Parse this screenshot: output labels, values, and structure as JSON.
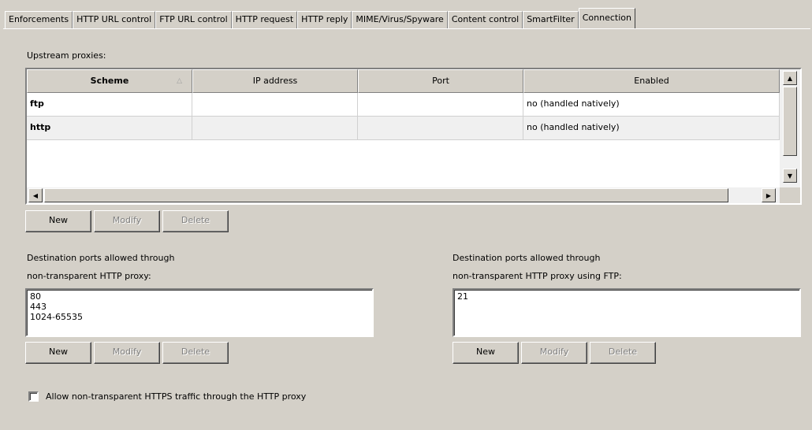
{
  "tabs": [
    {
      "label": "Enforcements",
      "active": false
    },
    {
      "label": "HTTP URL control",
      "active": false
    },
    {
      "label": "FTP URL control",
      "active": false
    },
    {
      "label": "HTTP request",
      "active": false
    },
    {
      "label": "HTTP reply",
      "active": false
    },
    {
      "label": "MIME/Virus/Spyware",
      "active": false
    },
    {
      "label": "Content control",
      "active": false
    },
    {
      "label": "SmartFilter",
      "active": false
    },
    {
      "label": "Connection",
      "active": true
    }
  ],
  "upstream": {
    "label": "Upstream proxies:",
    "columns": [
      "Scheme",
      "IP address",
      "Port",
      "Enabled"
    ],
    "sort_glyph": "△",
    "rows": [
      {
        "scheme": "ftp",
        "ip": "",
        "port": "",
        "enabled": "no (handled natively)"
      },
      {
        "scheme": "http",
        "ip": "",
        "port": "",
        "enabled": "no (handled natively)"
      }
    ],
    "buttons": {
      "new": "New",
      "modify": "Modify",
      "delete": "Delete"
    }
  },
  "dest_http": {
    "label_line1": "Destination ports allowed through",
    "label_line2": "non-transparent HTTP proxy:",
    "items": [
      "80",
      "443",
      "1024-65535"
    ],
    "buttons": {
      "new": "New",
      "modify": "Modify",
      "delete": "Delete"
    }
  },
  "dest_ftp": {
    "label_line1": "Destination ports allowed through",
    "label_line2": "non-transparent HTTP proxy using FTP:",
    "items": [
      "21"
    ],
    "buttons": {
      "new": "New",
      "modify": "Modify",
      "delete": "Delete"
    }
  },
  "https_checkbox": {
    "label": "Allow non-transparent HTTPS traffic through the HTTP proxy",
    "checked": false
  },
  "icons": {
    "scroll_up": "▲",
    "scroll_down": "▼",
    "scroll_left": "◀",
    "scroll_right": "▶"
  }
}
